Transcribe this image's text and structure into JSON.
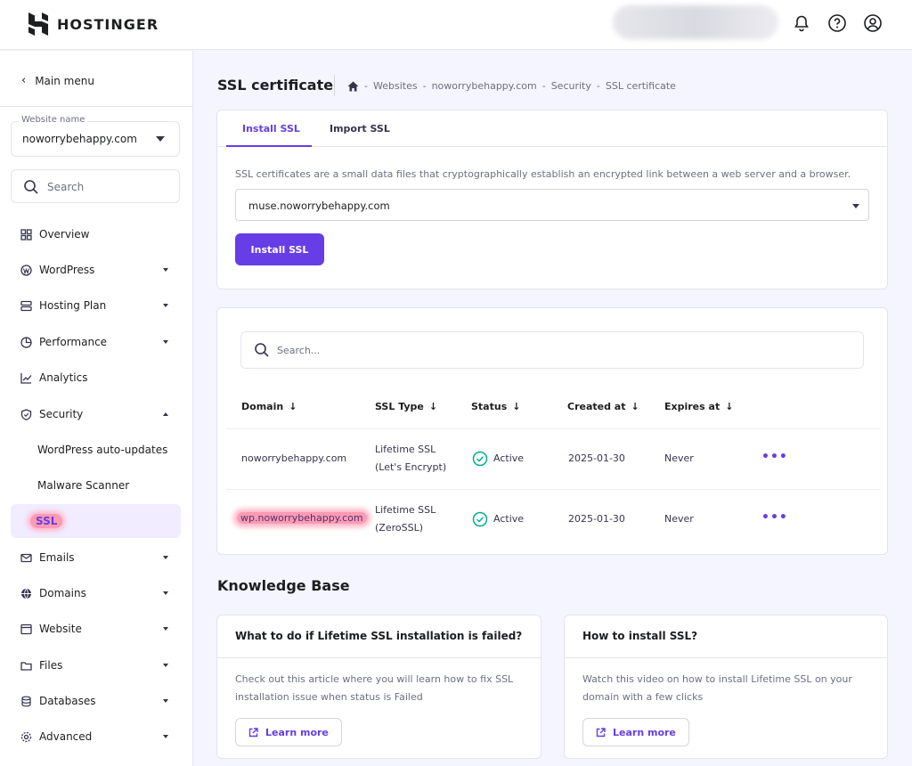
{
  "brand": {
    "name": "HOSTINGER"
  },
  "sidebar": {
    "main_menu": "Main menu",
    "website_label": "Website name",
    "website_value": "noworrybehappy.com",
    "search_placeholder": "Search",
    "items": [
      {
        "label": "Overview",
        "icon": "grid-icon"
      },
      {
        "label": "WordPress",
        "icon": "wordpress-icon"
      },
      {
        "label": "Hosting Plan",
        "icon": "server-icon"
      },
      {
        "label": "Performance",
        "icon": "pie-chart-icon"
      },
      {
        "label": "Analytics",
        "icon": "trend-icon"
      },
      {
        "label": "Security",
        "icon": "shield-icon"
      },
      {
        "label": "WordPress auto-updates"
      },
      {
        "label": "Malware Scanner"
      },
      {
        "label": "SSL"
      },
      {
        "label": "Emails",
        "icon": "mail-icon"
      },
      {
        "label": "Domains",
        "icon": "globe-icon"
      },
      {
        "label": "Website",
        "icon": "window-icon"
      },
      {
        "label": "Files",
        "icon": "folder-icon"
      },
      {
        "label": "Databases",
        "icon": "database-icon"
      },
      {
        "label": "Advanced",
        "icon": "gear-icon"
      }
    ]
  },
  "header": {
    "title": "SSL certificate",
    "breadcrumb": [
      "Websites",
      "noworrybehappy.com",
      "Security",
      "SSL certificate"
    ],
    "breadcrumb_sep": "-"
  },
  "install_card": {
    "tabs": [
      "Install SSL",
      "Import SSL"
    ],
    "description": "SSL certificates are a small data files that cryptographically establish an encrypted link between a web server and a browser.",
    "domain_value": "muse.noworrybehappy.com",
    "install_button": "Install SSL"
  },
  "ssl_table": {
    "search_placeholder": "Search...",
    "columns": [
      "Domain",
      "SSL Type",
      "Status",
      "Created at",
      "Expires at"
    ],
    "rows": [
      {
        "domain": "noworrybehappy.com",
        "type_line1": "Lifetime SSL",
        "type_line2": "(Let's Encrypt)",
        "status": "Active",
        "created": "2025-01-30",
        "expires": "Never",
        "menu": "•••"
      },
      {
        "domain": "wp.noworrybehappy.com",
        "type_line1": "Lifetime SSL",
        "type_line2": "(ZeroSSL)",
        "status": "Active",
        "created": "2025-01-30",
        "expires": "Never",
        "menu": "•••"
      }
    ]
  },
  "knowledge_base": {
    "title": "Knowledge Base",
    "cards": [
      {
        "title": "What to do if Lifetime SSL installation is failed?",
        "body": "Check out this article where you will learn how to fix SSL installation issue when status is Failed",
        "button": "Learn more"
      },
      {
        "title": "How to install SSL?",
        "body": "Watch this video on how to install Lifetime SSL on your domain with a few clicks",
        "button": "Learn more"
      }
    ]
  },
  "colors": {
    "accent": "#673de6",
    "success": "#00b090",
    "highlight": "#ff9ab4"
  }
}
